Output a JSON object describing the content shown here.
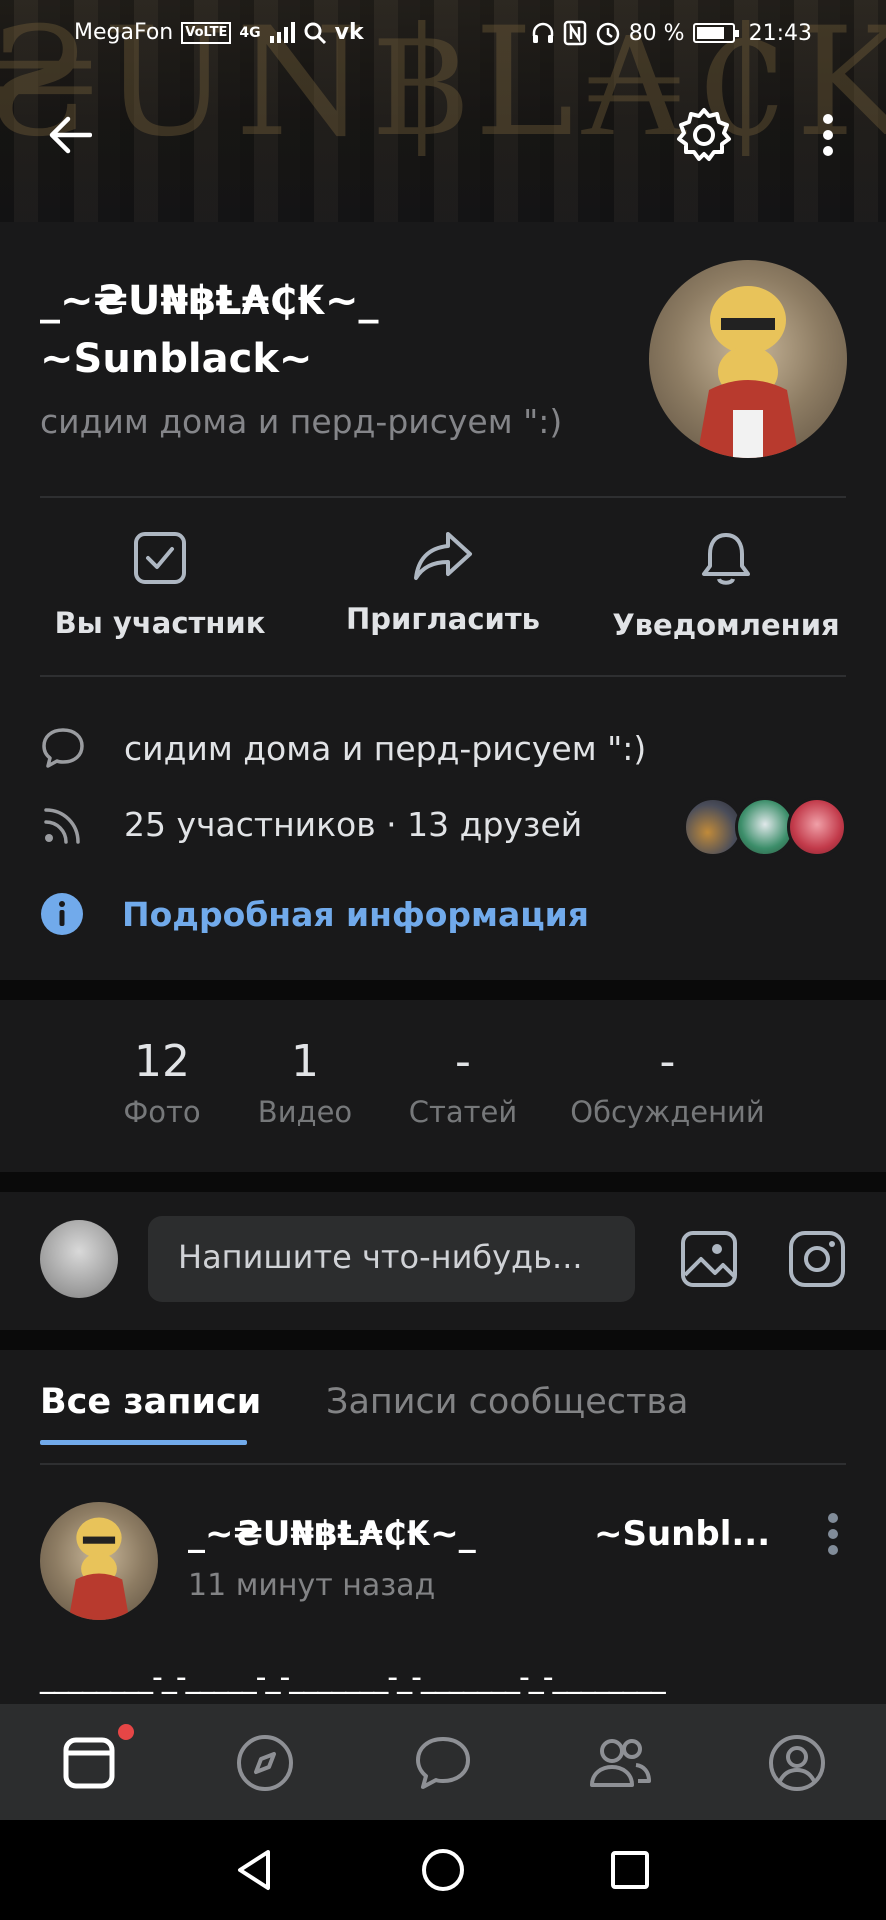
{
  "status_bar": {
    "carrier": "MegaFon",
    "volte": "VoLTE",
    "network": "4G",
    "battery_percent_text": "80 %",
    "battery_level": 0.8,
    "time": "21:43"
  },
  "cover": {
    "banner_text": "₴UN฿L₳₵K"
  },
  "group": {
    "name_line1": "_~₴U₦฿Ⱡ₳₵₭~_",
    "name_line2": "~Sunblack~",
    "status": "сидим дома и перд-рисуем \":)"
  },
  "actions": [
    {
      "label": "Вы участник",
      "icon": "checkbox-icon"
    },
    {
      "label": "Пригласить",
      "icon": "share-arrow-icon"
    },
    {
      "label": "Уведомления",
      "icon": "bell-icon"
    }
  ],
  "info": {
    "description": "сидим дома и перд-рисуем \":)",
    "members": "25 участников · 13 друзей",
    "more_info": "Подробная информация"
  },
  "counters": [
    {
      "value": "12",
      "label": "Фото"
    },
    {
      "value": "1",
      "label": "Видео"
    },
    {
      "value": "-",
      "label": "Статей"
    },
    {
      "value": "-",
      "label": "Обсуждений"
    }
  ],
  "composer": {
    "placeholder": "Напишите что-нибудь..."
  },
  "tabs": [
    {
      "label": "Все записи",
      "active": true
    },
    {
      "label": "Записи сообщества",
      "active": false
    }
  ],
  "post": {
    "author_part1": "_~₴U₦฿Ⱡ₳₵₭~_",
    "author_part2": "~Sunbl...",
    "time": "11 минут назад",
    "first_line": "________-_-_____-_-_______-_-_______-_-________"
  },
  "colors": {
    "background": "#19191a",
    "accent": "#71aaeb",
    "muted": "#828385",
    "notification": "#e64646"
  }
}
